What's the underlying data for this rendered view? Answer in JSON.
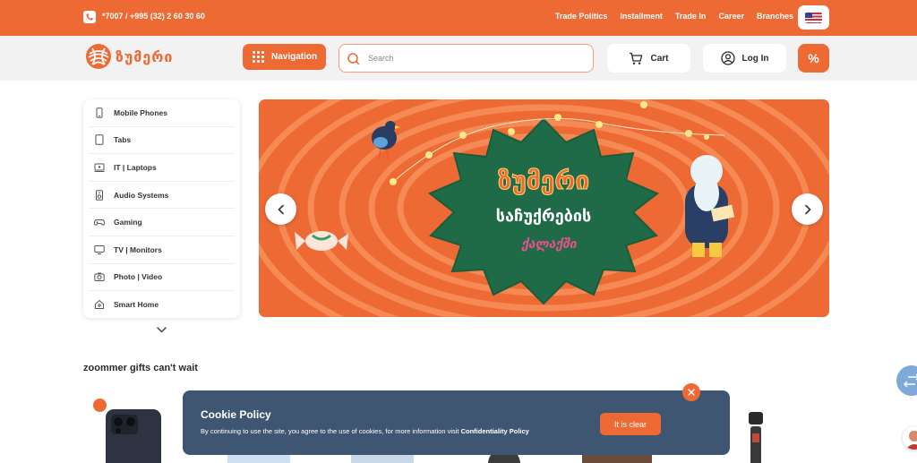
{
  "topbar": {
    "phone": "*7007 / +995 (32) 2 60 30 60",
    "links": [
      "Trade Politics",
      "Installment",
      "Trade In",
      "Career",
      "Branches"
    ],
    "language_icon": "us-flag-icon"
  },
  "header": {
    "logo_text": "ზუმერი",
    "nav_label": "Navigation",
    "search_placeholder": "Search",
    "cart_label": "Cart",
    "login_label": "Log In",
    "promo_label": "%"
  },
  "categories": [
    {
      "label": "Mobile Phones",
      "icon": "phone-icon"
    },
    {
      "label": "Tabs",
      "icon": "tablet-icon"
    },
    {
      "label": "IT | Laptops",
      "icon": "laptop-icon"
    },
    {
      "label": "Audio Systems",
      "icon": "speaker-icon"
    },
    {
      "label": "Gaming",
      "icon": "gamepad-icon"
    },
    {
      "label": "TV | Monitors",
      "icon": "tv-icon"
    },
    {
      "label": "Photo | Video",
      "icon": "camera-icon"
    },
    {
      "label": "Smart Home",
      "icon": "home-icon"
    }
  ],
  "banner": {
    "line1": "ზუმერი",
    "line2": "საჩუქრების",
    "line3": "ქალაქში"
  },
  "section": {
    "title": "zoommer gifts can't wait"
  },
  "cookie": {
    "title": "Cookie Policy",
    "text": "By continuing to use the site, you agree to the use of cookies, for more information visit",
    "link": "Confidentiality Policy",
    "button": "It is clear"
  },
  "colors": {
    "brand": "#ee6a35",
    "cookie_bg": "#3f5673",
    "banner_green": "#1f6b47"
  }
}
